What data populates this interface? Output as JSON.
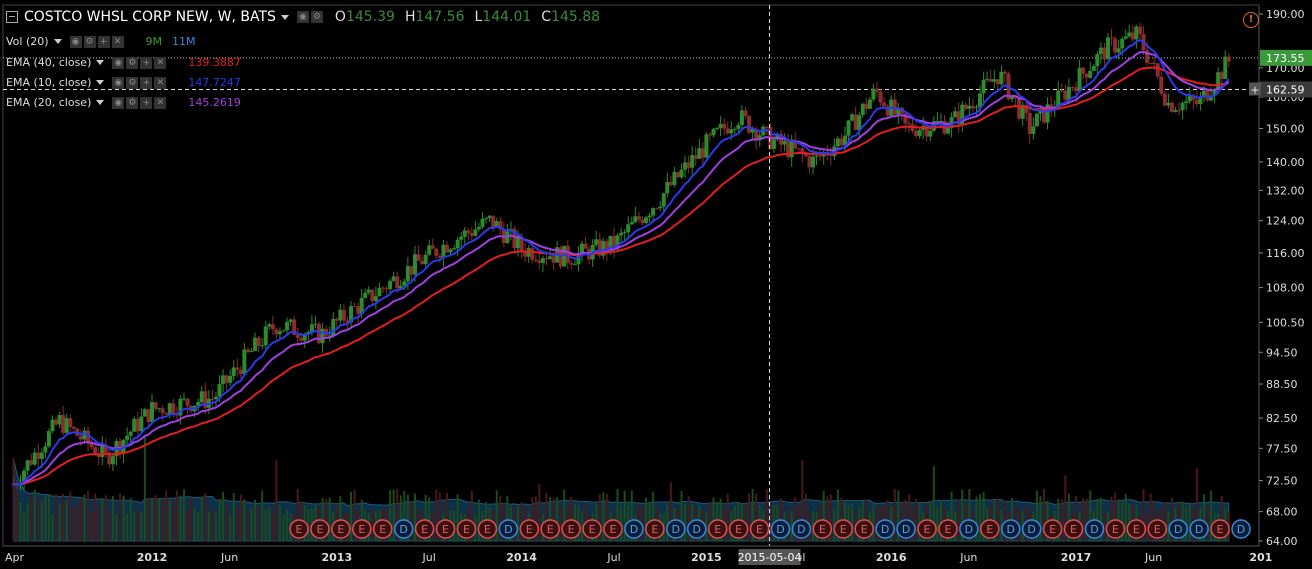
{
  "header": {
    "symbol_title": "COSTCO WHSL CORP NEW, W, BATS",
    "ohlc": [
      {
        "key": "O",
        "value": "145.39"
      },
      {
        "key": "H",
        "value": "147.56"
      },
      {
        "key": "L",
        "value": "144.01"
      },
      {
        "key": "C",
        "value": "145.88"
      }
    ]
  },
  "indicators": [
    {
      "label": "Vol (20)",
      "values": [
        {
          "text": "9M",
          "color": "#3aa03a"
        },
        {
          "text": "11M",
          "color": "#3a8ad8"
        }
      ]
    },
    {
      "label": "EMA (40, close)",
      "values": [
        {
          "text": "139.3887",
          "color": "#e02020"
        }
      ]
    },
    {
      "label": "EMA (10, close)",
      "values": [
        {
          "text": "147.7247",
          "color": "#2a3ae8"
        }
      ]
    },
    {
      "label": "EMA (20, close)",
      "values": [
        {
          "text": "145.2619",
          "color": "#a040e0"
        }
      ]
    }
  ],
  "chart_data": {
    "type": "candlestick",
    "title": "COSTCO WHSL CORP NEW, W, BATS",
    "y_scale": "log",
    "ylim": [
      64,
      190
    ],
    "y_ticks": [
      "190.00",
      "170.00",
      "160.00",
      "150.00",
      "140.00",
      "132.00",
      "124.00",
      "116.00",
      "108.00",
      "100.50",
      "94.50",
      "88.50",
      "82.50",
      "77.50",
      "72.50",
      "68.00",
      "64.00"
    ],
    "x_ticks": [
      "Apr",
      "2012",
      "Jun",
      "2013",
      "Jul",
      "2014",
      "Jul",
      "2015",
      "Jul",
      "2016",
      "Jun",
      "2017",
      "Jun",
      "201"
    ],
    "price_axis_badges": [
      {
        "text": "173.55",
        "color": "#3a9a3a"
      },
      {
        "text": "162.59",
        "color": "#3a3a3a"
      }
    ],
    "crosshair_date": "2015-05-04",
    "series_anchors": [
      {
        "date": "2011-04",
        "close": 72
      },
      {
        "date": "2011-07",
        "close": 82
      },
      {
        "date": "2011-10",
        "close": 76
      },
      {
        "date": "2012-01",
        "close": 84
      },
      {
        "date": "2012-05",
        "close": 86
      },
      {
        "date": "2012-09",
        "close": 100
      },
      {
        "date": "2012-12",
        "close": 98
      },
      {
        "date": "2013-04",
        "close": 108
      },
      {
        "date": "2013-08",
        "close": 118
      },
      {
        "date": "2013-11",
        "close": 124
      },
      {
        "date": "2014-01",
        "close": 117
      },
      {
        "date": "2014-04",
        "close": 115
      },
      {
        "date": "2014-07",
        "close": 118
      },
      {
        "date": "2014-10",
        "close": 130
      },
      {
        "date": "2015-01",
        "close": 145
      },
      {
        "date": "2015-03",
        "close": 154
      },
      {
        "date": "2015-05",
        "close": 147
      },
      {
        "date": "2015-08",
        "close": 140
      },
      {
        "date": "2015-10",
        "close": 148
      },
      {
        "date": "2015-12",
        "close": 162
      },
      {
        "date": "2016-02",
        "close": 150
      },
      {
        "date": "2016-05",
        "close": 152
      },
      {
        "date": "2016-08",
        "close": 168
      },
      {
        "date": "2016-10",
        "close": 150
      },
      {
        "date": "2016-12",
        "close": 160
      },
      {
        "date": "2017-03",
        "close": 177
      },
      {
        "date": "2017-05",
        "close": 182
      },
      {
        "date": "2017-07",
        "close": 158
      },
      {
        "date": "2017-09",
        "close": 158
      },
      {
        "date": "2017-11",
        "close": 173
      }
    ],
    "volume_ma": "Vol (20)",
    "event_markers": [
      "E",
      "E",
      "E",
      "E",
      "E",
      "D",
      "E",
      "E",
      "E",
      "E",
      "D",
      "E",
      "E",
      "E",
      "E",
      "E",
      "D",
      "E",
      "D",
      "D",
      "E",
      "E",
      "E",
      "D",
      "D",
      "E",
      "E",
      "E",
      "D",
      "D",
      "E",
      "E",
      "D",
      "E",
      "D",
      "D",
      "E",
      "E",
      "D",
      "E",
      "E",
      "E",
      "D",
      "D",
      "E",
      "D"
    ]
  }
}
